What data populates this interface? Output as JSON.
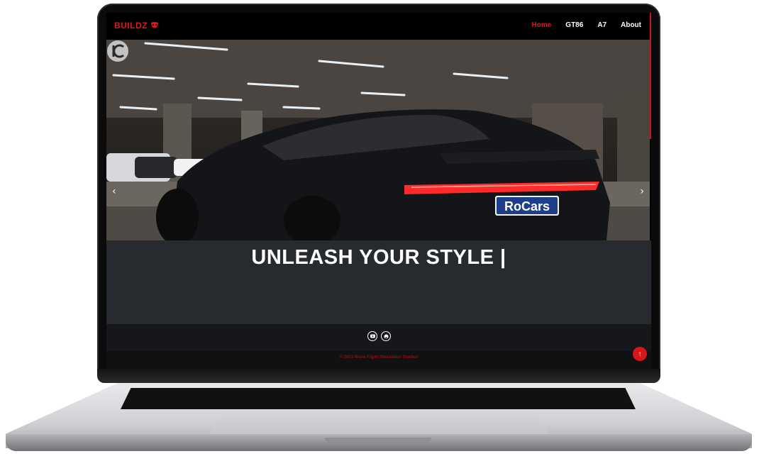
{
  "navbar": {
    "brand": "BUILDZ",
    "links": [
      {
        "label": "Home",
        "active": true
      },
      {
        "label": "GT86",
        "active": false
      },
      {
        "label": "A7",
        "active": false
      },
      {
        "label": "About",
        "active": false
      }
    ]
  },
  "hero": {
    "prev_glyph": "‹",
    "next_glyph": "›",
    "plate_text": "RoCars"
  },
  "headline": "UNLEASH YOUR STYLE |",
  "social": {
    "icons": [
      "youtube-icon",
      "github-icon"
    ]
  },
  "footer": {
    "copyright": "© 2023 Wave Flight Simulation Studios"
  },
  "back_to_top_glyph": "↑",
  "colors": {
    "accent": "#e3161b",
    "section_bg": "#272a2e",
    "footer_bg": "#101113"
  }
}
